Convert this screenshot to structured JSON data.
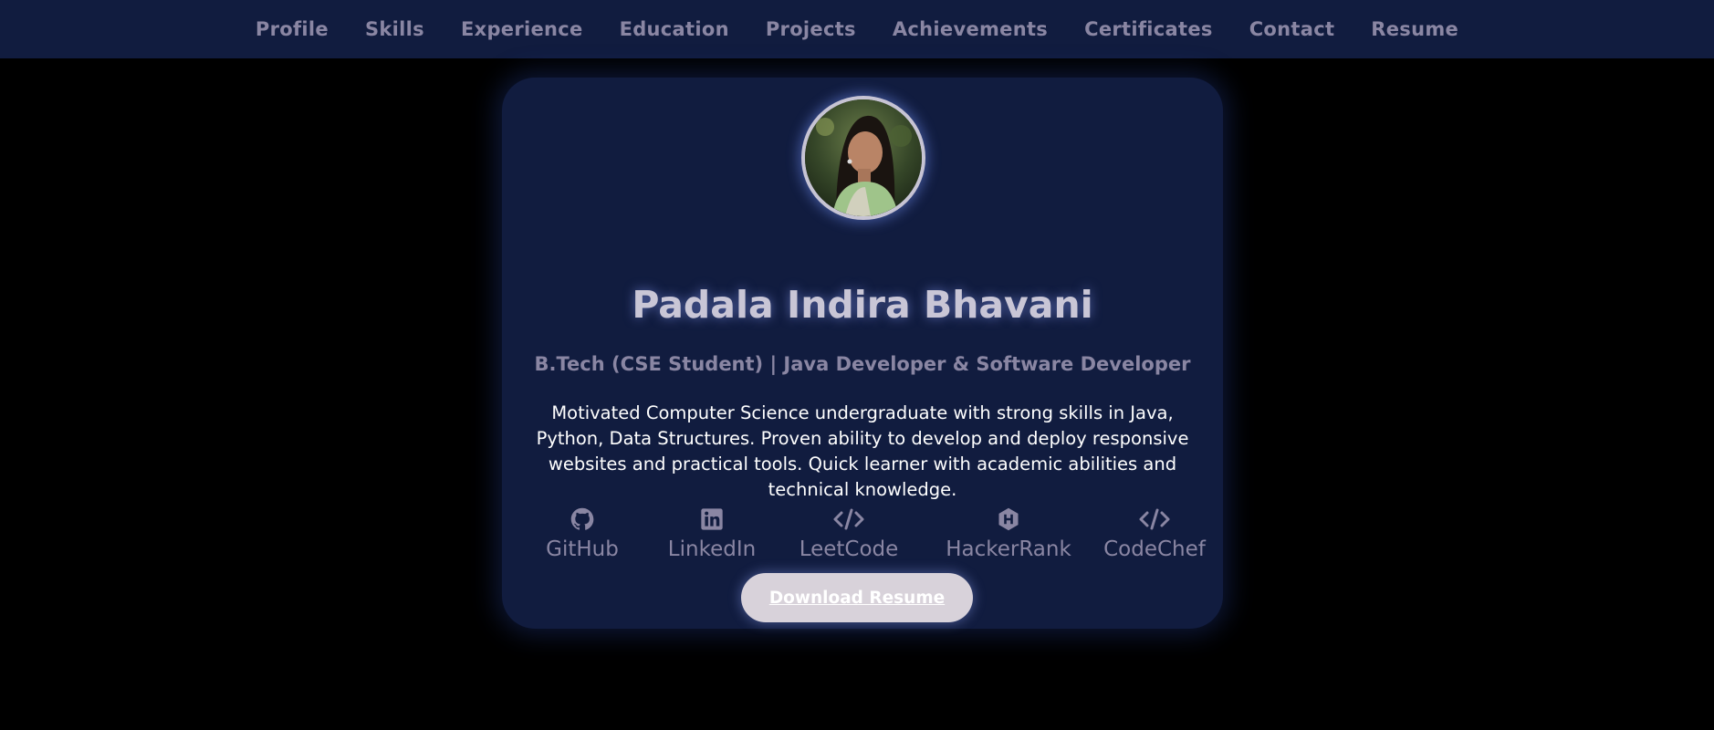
{
  "nav": {
    "items": [
      {
        "label": "Profile"
      },
      {
        "label": "Skills"
      },
      {
        "label": "Experience"
      },
      {
        "label": "Education"
      },
      {
        "label": "Projects"
      },
      {
        "label": "Achievements"
      },
      {
        "label": "Certificates"
      },
      {
        "label": "Contact"
      },
      {
        "label": "Resume"
      }
    ]
  },
  "profile": {
    "name": "Padala Indira Bhavani",
    "subtitle": "B.Tech (CSE Student) | Java Developer & Software Developer",
    "summary": "Motivated Computer Science undergraduate with strong skills in Java, Python, Data Structures. Proven ability to develop and deploy responsive websites and practical tools. Quick learner with academic abilities and technical knowledge.",
    "avatar_icon": "profile-photo"
  },
  "socials": [
    {
      "label": "GitHub",
      "icon": "github-icon"
    },
    {
      "label": "LinkedIn",
      "icon": "linkedin-icon"
    },
    {
      "label": "LeetCode",
      "icon": "code-icon"
    },
    {
      "label": "HackerRank",
      "icon": "hackerrank-icon"
    },
    {
      "label": "CodeChef",
      "icon": "code-icon"
    }
  ],
  "actions": {
    "download_label": "Download Resume"
  },
  "colors": {
    "background": "#000000",
    "navbar": "#111c3f",
    "card": "#111c3f",
    "muted_text": "#8a86a3",
    "heading": "#c9c6d6",
    "body_text": "#ffffff",
    "button": "#d8d2da"
  }
}
